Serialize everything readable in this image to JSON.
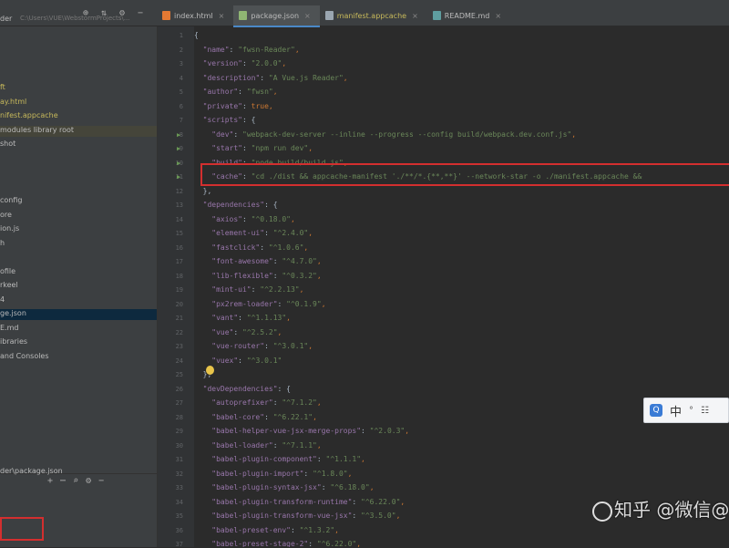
{
  "project": {
    "name": "der",
    "path": "C:\\Users\\VUE\\WebstormProjects\\..."
  },
  "toolbar_icons": [
    "globe-icon",
    "split-icon",
    "gear-icon",
    "minimize-icon"
  ],
  "tabs": [
    {
      "label": "index.html",
      "active": false,
      "modified": false,
      "icon_color": "#e37933"
    },
    {
      "label": "package.json",
      "active": true,
      "modified": false,
      "icon_color": "#8fb573"
    },
    {
      "label": "manifest.appcache",
      "active": false,
      "modified": true,
      "icon_color": "#9aa6b1"
    },
    {
      "label": "README.md",
      "active": false,
      "modified": false,
      "icon_color": "#5f9ea0"
    }
  ],
  "sidebar": {
    "items": [
      {
        "label": "",
        "color": "#bbbbbb"
      },
      {
        "label": "",
        "color": "#bbbbbb"
      },
      {
        "label": "",
        "color": "#bbbbbb"
      },
      {
        "label": "",
        "color": "#bbbbbb"
      },
      {
        "label": "ft",
        "color": "#c7b95b"
      },
      {
        "label": "ay.html",
        "color": "#c7b95b"
      },
      {
        "label": "nifest.appcache",
        "color": "#c7b95b"
      },
      {
        "label": "modules  library root",
        "color": "#bbbbbb"
      },
      {
        "label": "shot",
        "color": "#bbbbbb"
      },
      {
        "label": "",
        "color": "#bbbbbb"
      },
      {
        "label": "",
        "color": "#bbbbbb"
      },
      {
        "label": "",
        "color": "#bbbbbb"
      },
      {
        "label": "config",
        "color": "#bbbbbb"
      },
      {
        "label": "ore",
        "color": "#bbbbbb"
      },
      {
        "label": "ion.js",
        "color": "#bbbbbb"
      },
      {
        "label": "h",
        "color": "#bbbbbb"
      },
      {
        "label": "",
        "color": "#bbbbbb"
      },
      {
        "label": "ofile",
        "color": "#bbbbbb"
      },
      {
        "label": "rkeel",
        "color": "#bbbbbb"
      },
      {
        "label": "4",
        "color": "#bbbbbb"
      },
      {
        "label": "ge.json",
        "color": "#bbbbbb"
      },
      {
        "label": "E.md",
        "color": "#bbbbbb"
      },
      {
        "label": "ibraries",
        "color": "#bbbbbb"
      },
      {
        "label": " and Consoles",
        "color": "#bbbbbb"
      }
    ],
    "selected_index": 20,
    "highlight_index": 7,
    "bottom_path": "der\\package.json",
    "bottom_icons": [
      "add-icon",
      "collapse-icon",
      "search-icon",
      "gear-icon",
      "minimize-icon"
    ]
  },
  "code": {
    "start_line": 1,
    "lines": [
      [
        [
          "{",
          "b"
        ]
      ],
      [
        [
          "  ",
          "b"
        ],
        [
          "\"name\"",
          "k"
        ],
        [
          ": ",
          "b"
        ],
        [
          "\"fwsn-Reader\"",
          "s"
        ],
        [
          ",",
          "p"
        ]
      ],
      [
        [
          "  ",
          "b"
        ],
        [
          "\"version\"",
          "k"
        ],
        [
          ": ",
          "b"
        ],
        [
          "\"2.0.0\"",
          "s"
        ],
        [
          ",",
          "p"
        ]
      ],
      [
        [
          "  ",
          "b"
        ],
        [
          "\"description\"",
          "k"
        ],
        [
          ": ",
          "b"
        ],
        [
          "\"A Vue.js Reader\"",
          "s"
        ],
        [
          ",",
          "p"
        ]
      ],
      [
        [
          "  ",
          "b"
        ],
        [
          "\"author\"",
          "k"
        ],
        [
          ": ",
          "b"
        ],
        [
          "\"fwsn\"",
          "s"
        ],
        [
          ",",
          "p"
        ]
      ],
      [
        [
          "  ",
          "b"
        ],
        [
          "\"private\"",
          "k"
        ],
        [
          ": ",
          "b"
        ],
        [
          "true",
          "p"
        ],
        [
          ",",
          "p"
        ]
      ],
      [
        [
          "  ",
          "b"
        ],
        [
          "\"scripts\"",
          "k"
        ],
        [
          ": {",
          "b"
        ]
      ],
      [
        [
          "    ",
          "b"
        ],
        [
          "\"dev\"",
          "k"
        ],
        [
          ": ",
          "b"
        ],
        [
          "\"webpack-dev-server --inline --progress --config build/webpack.dev.conf.js\"",
          "s"
        ],
        [
          ",",
          "p"
        ]
      ],
      [
        [
          "    ",
          "b"
        ],
        [
          "\"start\"",
          "k"
        ],
        [
          ": ",
          "b"
        ],
        [
          "\"npm run dev\"",
          "s"
        ],
        [
          ",",
          "p"
        ]
      ],
      [
        [
          "    ",
          "b"
        ],
        [
          "\"build\"",
          "k"
        ],
        [
          ": ",
          "b"
        ],
        [
          "\"node build/build.js\"",
          "s"
        ],
        [
          ",",
          "p"
        ]
      ],
      [
        [
          "    ",
          "b"
        ],
        [
          "\"cache\"",
          "k"
        ],
        [
          ": ",
          "b"
        ],
        [
          "\"cd ./dist && appcache-manifest './**/*.{**,**}' --network-star -o ./manifest.appcache &&",
          "s"
        ]
      ],
      [
        [
          "  ",
          "b"
        ],
        [
          "},",
          "b"
        ]
      ],
      [
        [
          "  ",
          "b"
        ],
        [
          "\"dependencies\"",
          "k"
        ],
        [
          ": {",
          "b"
        ]
      ],
      [
        [
          "    ",
          "b"
        ],
        [
          "\"axios\"",
          "k"
        ],
        [
          ": ",
          "b"
        ],
        [
          "\"^0.18.0\"",
          "s"
        ],
        [
          ",",
          "p"
        ]
      ],
      [
        [
          "    ",
          "b"
        ],
        [
          "\"element-ui\"",
          "k"
        ],
        [
          ": ",
          "b"
        ],
        [
          "\"^2.4.0\"",
          "s"
        ],
        [
          ",",
          "p"
        ]
      ],
      [
        [
          "    ",
          "b"
        ],
        [
          "\"fastclick\"",
          "k"
        ],
        [
          ": ",
          "b"
        ],
        [
          "\"^1.0.6\"",
          "s"
        ],
        [
          ",",
          "p"
        ]
      ],
      [
        [
          "    ",
          "b"
        ],
        [
          "\"font-awesome\"",
          "k"
        ],
        [
          ": ",
          "b"
        ],
        [
          "\"^4.7.0\"",
          "s"
        ],
        [
          ",",
          "p"
        ]
      ],
      [
        [
          "    ",
          "b"
        ],
        [
          "\"lib-flexible\"",
          "k"
        ],
        [
          ": ",
          "b"
        ],
        [
          "\"^0.3.2\"",
          "s"
        ],
        [
          ",",
          "p"
        ]
      ],
      [
        [
          "    ",
          "b"
        ],
        [
          "\"mint-ui\"",
          "k"
        ],
        [
          ": ",
          "b"
        ],
        [
          "\"^2.2.13\"",
          "s"
        ],
        [
          ",",
          "p"
        ]
      ],
      [
        [
          "    ",
          "b"
        ],
        [
          "\"px2rem-loader\"",
          "k"
        ],
        [
          ": ",
          "b"
        ],
        [
          "\"^0.1.9\"",
          "s"
        ],
        [
          ",",
          "p"
        ]
      ],
      [
        [
          "    ",
          "b"
        ],
        [
          "\"vant\"",
          "k"
        ],
        [
          ": ",
          "b"
        ],
        [
          "\"^1.1.13\"",
          "s"
        ],
        [
          ",",
          "p"
        ]
      ],
      [
        [
          "    ",
          "b"
        ],
        [
          "\"vue\"",
          "k"
        ],
        [
          ": ",
          "b"
        ],
        [
          "\"^2.5.2\"",
          "s"
        ],
        [
          ",",
          "p"
        ]
      ],
      [
        [
          "    ",
          "b"
        ],
        [
          "\"vue-router\"",
          "k"
        ],
        [
          ": ",
          "b"
        ],
        [
          "\"^3.0.1\"",
          "s"
        ],
        [
          ",",
          "p"
        ]
      ],
      [
        [
          "    ",
          "b"
        ],
        [
          "\"vuex\"",
          "k"
        ],
        [
          ": ",
          "b"
        ],
        [
          "\"^3.0.1\"",
          "s"
        ]
      ],
      [
        [
          "  ",
          "b"
        ],
        [
          "},",
          "b"
        ]
      ],
      [
        [
          "  ",
          "b"
        ],
        [
          "\"devDependencies\"",
          "k"
        ],
        [
          ": {",
          "b"
        ]
      ],
      [
        [
          "    ",
          "b"
        ],
        [
          "\"autoprefixer\"",
          "k"
        ],
        [
          ": ",
          "b"
        ],
        [
          "\"^7.1.2\"",
          "s"
        ],
        [
          ",",
          "p"
        ]
      ],
      [
        [
          "    ",
          "b"
        ],
        [
          "\"babel-core\"",
          "k"
        ],
        [
          ": ",
          "b"
        ],
        [
          "\"^6.22.1\"",
          "s"
        ],
        [
          ",",
          "p"
        ]
      ],
      [
        [
          "    ",
          "b"
        ],
        [
          "\"babel-helper-vue-jsx-merge-props\"",
          "k"
        ],
        [
          ": ",
          "b"
        ],
        [
          "\"^2.0.3\"",
          "s"
        ],
        [
          ",",
          "p"
        ]
      ],
      [
        [
          "    ",
          "b"
        ],
        [
          "\"babel-loader\"",
          "k"
        ],
        [
          ": ",
          "b"
        ],
        [
          "\"^7.1.1\"",
          "s"
        ],
        [
          ",",
          "p"
        ]
      ],
      [
        [
          "    ",
          "b"
        ],
        [
          "\"babel-plugin-component\"",
          "k"
        ],
        [
          ": ",
          "b"
        ],
        [
          "\"^1.1.1\"",
          "s"
        ],
        [
          ",",
          "p"
        ]
      ],
      [
        [
          "    ",
          "b"
        ],
        [
          "\"babel-plugin-import\"",
          "k"
        ],
        [
          ": ",
          "b"
        ],
        [
          "\"^1.8.0\"",
          "s"
        ],
        [
          ",",
          "p"
        ]
      ],
      [
        [
          "    ",
          "b"
        ],
        [
          "\"babel-plugin-syntax-jsx\"",
          "k"
        ],
        [
          ": ",
          "b"
        ],
        [
          "\"^6.18.0\"",
          "s"
        ],
        [
          ",",
          "p"
        ]
      ],
      [
        [
          "    ",
          "b"
        ],
        [
          "\"babel-plugin-transform-runtime\"",
          "k"
        ],
        [
          ": ",
          "b"
        ],
        [
          "\"^6.22.0\"",
          "s"
        ],
        [
          ",",
          "p"
        ]
      ],
      [
        [
          "    ",
          "b"
        ],
        [
          "\"babel-plugin-transform-vue-jsx\"",
          "k"
        ],
        [
          ": ",
          "b"
        ],
        [
          "\"^3.5.0\"",
          "s"
        ],
        [
          ",",
          "p"
        ]
      ],
      [
        [
          "    ",
          "b"
        ],
        [
          "\"babel-preset-env\"",
          "k"
        ],
        [
          ": ",
          "b"
        ],
        [
          "\"^1.3.2\"",
          "s"
        ],
        [
          ",",
          "p"
        ]
      ],
      [
        [
          "    ",
          "b"
        ],
        [
          "\"babel-preset-stage-2\"",
          "k"
        ],
        [
          ": ",
          "b"
        ],
        [
          "\"^6.22.0\"",
          "s"
        ],
        [
          ",",
          "p"
        ]
      ]
    ],
    "run_markers": [
      8,
      9,
      10,
      11
    ]
  },
  "ime": {
    "logo": "Q",
    "mode": "中",
    "punct": "°",
    "extra": "☷"
  },
  "watermark": "知乎 @微信@开罗",
  "colors": {
    "highlight_box": "#d32f2f",
    "accent": "#4a88c7"
  }
}
